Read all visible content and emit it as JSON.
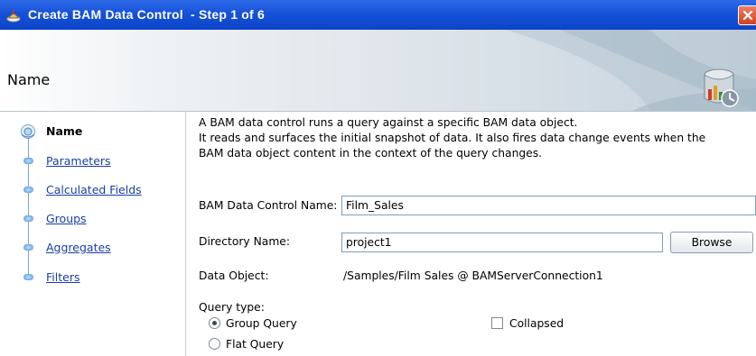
{
  "window": {
    "title": "Create BAM Data Control  - Step 1 of 6",
    "colors": {
      "titlebar": "#1552d8",
      "close": "#d3421f"
    }
  },
  "header": {
    "title": "Name"
  },
  "nav": {
    "items": [
      {
        "label": "Name",
        "current": true
      },
      {
        "label": "Parameters",
        "current": false
      },
      {
        "label": "Calculated Fields",
        "current": false
      },
      {
        "label": "Groups",
        "current": false
      },
      {
        "label": "Aggregates",
        "current": false
      },
      {
        "label": "Filters",
        "current": false
      }
    ]
  },
  "description": {
    "lines": [
      "A BAM data control runs a query against a specific BAM data object.",
      "It reads and surfaces the initial snapshot of data. It also fires data change events when the",
      "BAM data object content in the context of the query changes."
    ]
  },
  "form": {
    "control_name_label": "BAM Data Control Name:",
    "control_name_value": "Film_Sales",
    "directory_label": "Directory Name:",
    "directory_value": "project1",
    "browse_label": "Browse",
    "data_object_label": "Data Object:",
    "data_object_value": "/Samples/Film Sales @ BAMServerConnection1",
    "query_type_label": "Query type:",
    "group_query_label": "Group Query",
    "group_query_selected": true,
    "flat_query_label": "Flat Query",
    "flat_query_selected": false,
    "collapsed_label": "Collapsed",
    "collapsed_checked": false
  }
}
